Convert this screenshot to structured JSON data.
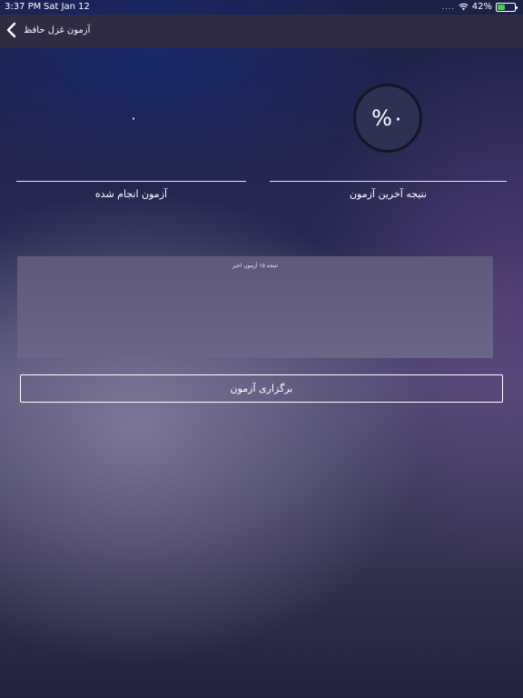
{
  "status_bar": {
    "time": "3:37 PM",
    "date": "Sat Jan 12",
    "signal_dots": "....",
    "battery": "42%",
    "battery_level": 0.42
  },
  "nav": {
    "back_label": "آزمون غزل حافظ"
  },
  "stats": {
    "last_result_value": "%۰",
    "last_result_label": "نتیجه آخرین آزمون",
    "completed_value": "۰",
    "completed_label": "آزمون انجام شده"
  },
  "chart_data": {
    "type": "line",
    "title": "نتیجه ۱۵ آزمون اخیر",
    "series": []
  },
  "actions": {
    "start_label": "برگزاری آزمون"
  },
  "colors": {
    "nav_bg": "#2e2c40",
    "circle_bg": "#2d3152",
    "battery_fill": "#3fd14a"
  }
}
